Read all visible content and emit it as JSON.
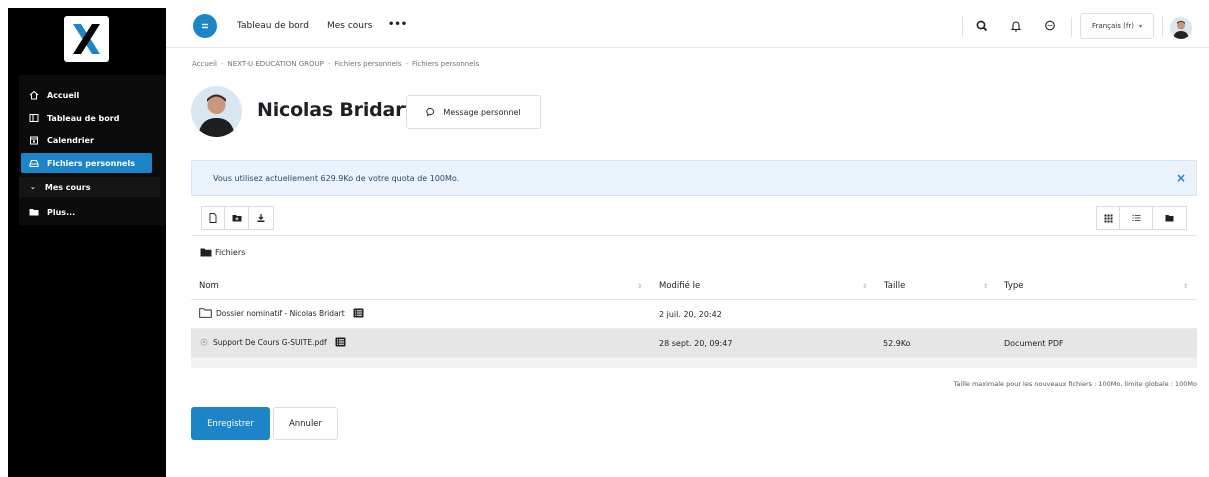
{
  "sidebar": {
    "logo_icon": "x-logo-icon",
    "items": [
      {
        "label": "Accueil",
        "icon": "home-icon"
      },
      {
        "label": "Tableau de bord",
        "icon": "dashboard-icon"
      },
      {
        "label": "Calendrier",
        "icon": "calendar-icon"
      },
      {
        "label": "Fichiers personnels",
        "icon": "drive-icon"
      },
      {
        "label": "Mes cours",
        "icon": "chevron-down-icon"
      },
      {
        "label": "Plus...",
        "icon": "folder-icon"
      }
    ]
  },
  "topbar": {
    "nav": [
      "Tableau de bord",
      "Mes cours"
    ],
    "more": "•••",
    "language": "Français (fr)"
  },
  "breadcrumb": [
    "Accueil",
    "NEXT-U EDUCATION GROUP",
    "Fichiers personnels",
    "Fichiers personnels"
  ],
  "breadcrumb_sep": "-",
  "profile": {
    "name": "Nicolas Bridart",
    "message_button": "Message personnel"
  },
  "alert": {
    "text": "Vous utilisez actuellement 629.9Ko de votre quota de 100Mo.",
    "close": "×"
  },
  "filemanager": {
    "path_label": "Fichiers",
    "columns": [
      "Nom",
      "Modifié le",
      "Taille",
      "Type"
    ],
    "rows": [
      {
        "name": "Dossier nominatif - Nicolas Bridart",
        "modified": "2 juil. 20, 20:42",
        "size": "",
        "type": "",
        "kind": "folder"
      },
      {
        "name": "Support De Cours G-SUITE.pdf",
        "modified": "28 sept. 20, 09:47",
        "size": "52.9Ko",
        "type": "Document PDF",
        "kind": "pdf"
      }
    ],
    "limit_text": "Taille maximale pour les nouveaux fichiers : 100Mo, limite globale : 100Mo"
  },
  "actions": {
    "save": "Enregistrer",
    "cancel": "Annuler"
  },
  "colors": {
    "accent": "#1c85c7",
    "sidebar_bg": "#000000",
    "alert_bg": "#eaf2fb"
  }
}
